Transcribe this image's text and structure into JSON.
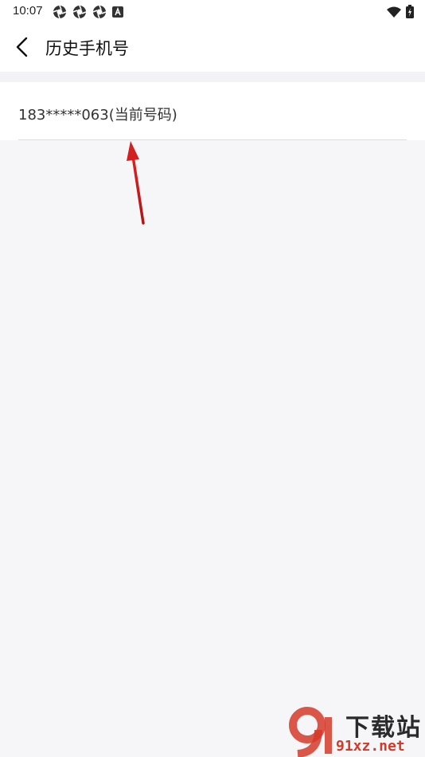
{
  "status_bar": {
    "time": "10:07",
    "left_icons": [
      "aperture-icon",
      "aperture-icon",
      "aperture-icon",
      "a-badge-icon"
    ],
    "right_icons": [
      "wifi-icon",
      "battery-charging-icon"
    ]
  },
  "header": {
    "back_icon": "chevron-left-icon",
    "title": "历史手机号"
  },
  "list": {
    "items": [
      {
        "label": "183*****063(当前号码)"
      }
    ]
  },
  "annotation": {
    "arrow_color": "#d21f1f"
  },
  "watermark": {
    "logo_text": "9",
    "top_text": "下载站",
    "bottom_text": "91xz.net",
    "accent": "#d43a2a"
  },
  "colors": {
    "background": "#f6f6f9",
    "surface": "#ffffff",
    "divider": "#dddddd"
  }
}
